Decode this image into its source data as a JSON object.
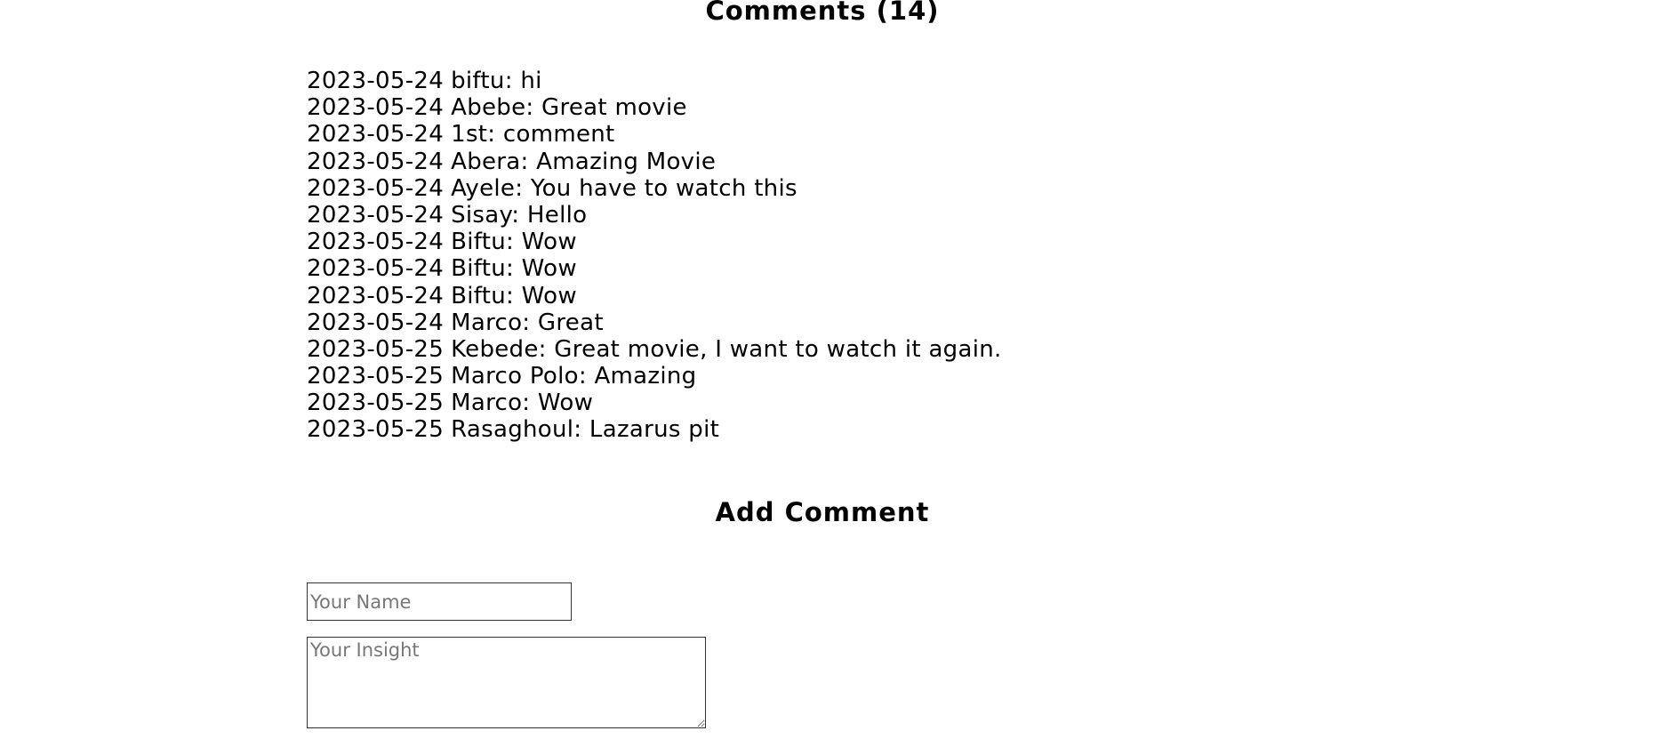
{
  "comments_section": {
    "title": "Comments (14)",
    "items": [
      {
        "date": "2023-05-24",
        "text": "biftu: hi"
      },
      {
        "date": "2023-05-24",
        "text": "Abebe: Great movie"
      },
      {
        "date": "2023-05-24",
        "text": "1st: comment"
      },
      {
        "date": "2023-05-24",
        "text": "Abera: Amazing Movie"
      },
      {
        "date": "2023-05-24",
        "text": "Ayele: You have to watch this"
      },
      {
        "date": "2023-05-24",
        "text": "Sisay: Hello"
      },
      {
        "date": "2023-05-24",
        "text": "Biftu: Wow"
      },
      {
        "date": "2023-05-24",
        "text": "Biftu: Wow"
      },
      {
        "date": "2023-05-24",
        "text": "Biftu: Wow"
      },
      {
        "date": "2023-05-24",
        "text": "Marco: Great"
      },
      {
        "date": "2023-05-25",
        "text": "Kebede: Great movie, I want to watch it again."
      },
      {
        "date": "2023-05-25",
        "text": "Marco Polo: Amazing"
      },
      {
        "date": "2023-05-25",
        "text": "Marco: Wow"
      },
      {
        "date": "2023-05-25",
        "text": "Rasaghoul: Lazarus pit"
      }
    ]
  },
  "add_comment": {
    "title": "Add Comment",
    "name_value": "",
    "name_placeholder": "Your Name",
    "insight_value": "",
    "insight_placeholder": "Your Insight"
  }
}
